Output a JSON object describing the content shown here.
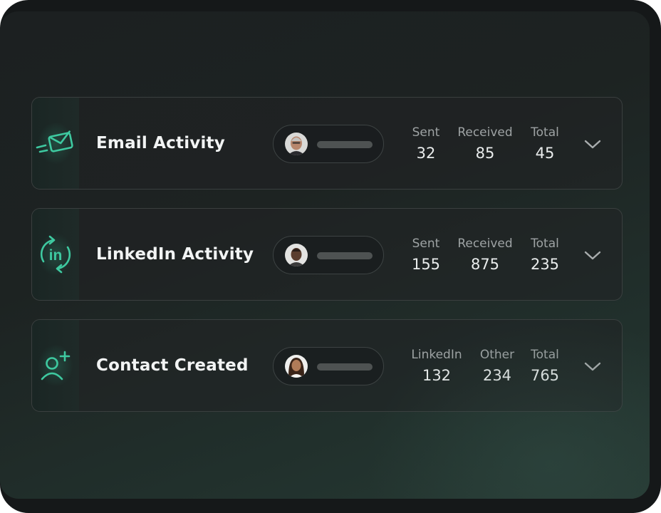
{
  "cards": [
    {
      "title": "Email Activity",
      "icon": "email-send-icon",
      "stats": [
        {
          "label": "Sent",
          "value": "32"
        },
        {
          "label": "Received",
          "value": "85"
        },
        {
          "label": "Total",
          "value": "45"
        }
      ]
    },
    {
      "title": "LinkedIn Activity",
      "icon": "linkedin-sync-icon",
      "icon_text": "in",
      "stats": [
        {
          "label": "Sent",
          "value": "155"
        },
        {
          "label": "Received",
          "value": "875"
        },
        {
          "label": "Total",
          "value": "235"
        }
      ]
    },
    {
      "title": "Contact Created",
      "icon": "add-contact-icon",
      "stats": [
        {
          "label": "LinkedIn",
          "value": "132"
        },
        {
          "label": "Other",
          "value": "234"
        },
        {
          "label": "Total",
          "value": "765"
        }
      ]
    }
  ],
  "colors": {
    "accent": "#3ec9a0",
    "background": "#1d2322",
    "text_primary": "#f2f4f4",
    "text_secondary": "#9ea3a4"
  }
}
